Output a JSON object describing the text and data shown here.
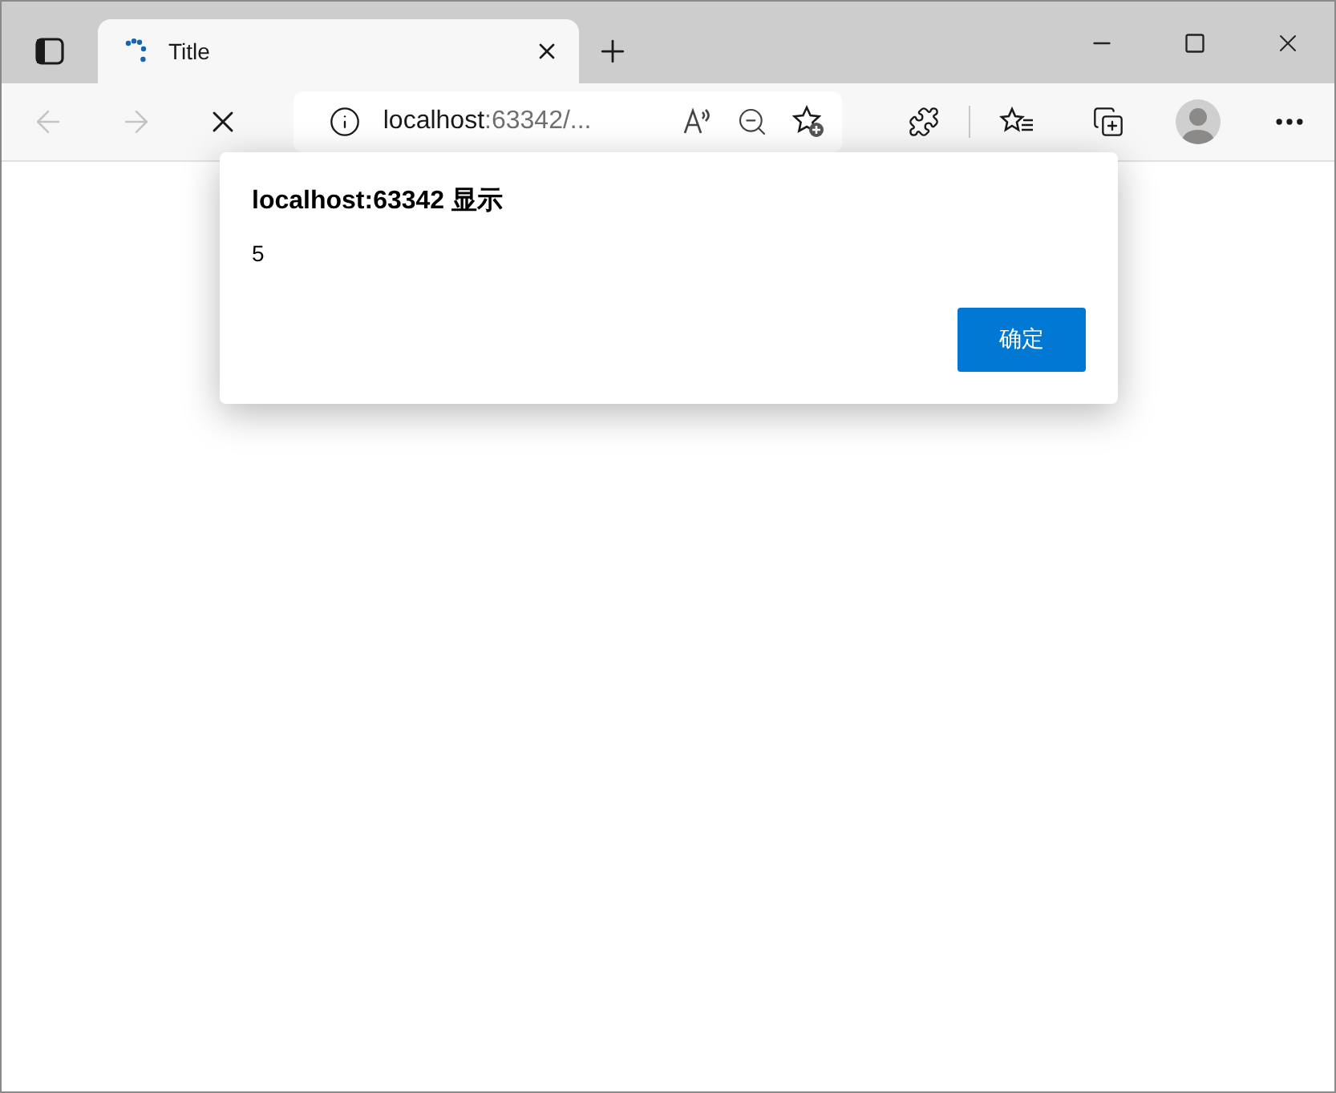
{
  "tabs": [
    {
      "title": "Title",
      "selected": true,
      "loading": true
    }
  ],
  "address": {
    "host": "localhost",
    "rest": ":63342/..."
  },
  "dialog": {
    "title": "localhost:63342 显示",
    "message": "5",
    "button": "确定"
  }
}
